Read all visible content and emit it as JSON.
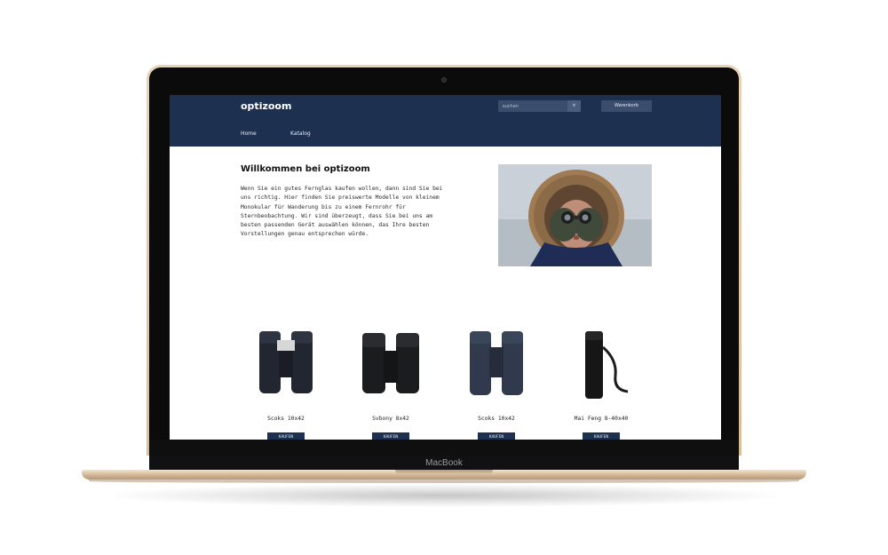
{
  "device": {
    "brand_label": "MacBook"
  },
  "site": {
    "logo": "optizoom",
    "search": {
      "placeholder": "suchen",
      "button_glyph": "×"
    },
    "cart_label": "Warenkorb",
    "nav": [
      {
        "label": "Home"
      },
      {
        "label": "Katalog"
      }
    ]
  },
  "welcome": {
    "title": "Willkommen bei optizoom",
    "text": "Wenn Sie ein gutes Fernglas kaufen wollen, dann sind Sie bei uns richtig. Hier finden Sie preiswerte Modelle von kleinem Monokular für Wanderung bis zu einem Fernrohr für Sternbeobachtung. Wir sind überzeugt, dass Sie bei uns am besten passenden Gerät auswählen können, das Ihre besten Vorstellungen genau entsprechen würde."
  },
  "products": [
    {
      "name": "Scoks 10x42",
      "button": "KAUFEN",
      "icon": "binoculars-icon"
    },
    {
      "name": "Svbony 8x42",
      "button": "KAUFEN",
      "icon": "binoculars-icon"
    },
    {
      "name": "Scoks 10x42",
      "button": "KAUFEN",
      "icon": "binoculars-icon"
    },
    {
      "name": "Mai Feng 8-40x40",
      "button": "KAUFEN",
      "icon": "monocular-icon"
    }
  ],
  "colors": {
    "header_bg": "#1e3050",
    "button_bg": "#1e3050",
    "laptop_gold": "#d9bc98"
  }
}
